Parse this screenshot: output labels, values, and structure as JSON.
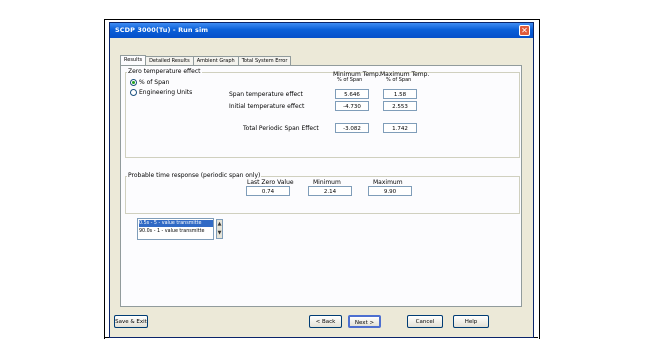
{
  "window": {
    "title": "SCDP 3000(Tu) - Run sim",
    "close_glyph": "✕"
  },
  "tabs": [
    "Results",
    "Detailed Results",
    "Ambient Graph",
    "Total System Error"
  ],
  "zero_temp": {
    "group_label": "Zero temperature effect",
    "radio_pct": "% of Span",
    "radio_eng": "Engineering Units",
    "col_min_header": "Minimum Temp.",
    "col_min_sub": "% of Span",
    "col_max_header": "Maximum Temp.",
    "col_max_sub": "% of Span",
    "rows": [
      {
        "label": "Span temperature effect",
        "min": "5.646",
        "max": "1.58"
      },
      {
        "label": "Initial temperature effect",
        "min": "-4.730",
        "max": "2.553"
      },
      {
        "label": "Total Periodic Span Effect",
        "min": "-3.082",
        "max": "1.742"
      }
    ]
  },
  "probable": {
    "group_label": "Probable time response (periodic span only)",
    "list_items": [
      "0.5s - 5 - value transmitte",
      "90.0s - 1 - value transmitte"
    ],
    "col_last_zero": "Last Zero Value",
    "col_min": "Minimum",
    "col_max": "Maximum",
    "last_zero_val": "0.74",
    "min_val": "2.14",
    "max_val": "9.90",
    "spin_up": "▲",
    "spin_down": "▼"
  },
  "buttons": {
    "save_exit": "Save & Exit",
    "back": "< Back",
    "next": "Next >",
    "cancel": "Cancel",
    "help": "Help"
  },
  "colors": {
    "titlebar": "#0a5fd8",
    "selection": "#316ac5",
    "dialog_bg": "#ece9d8"
  }
}
